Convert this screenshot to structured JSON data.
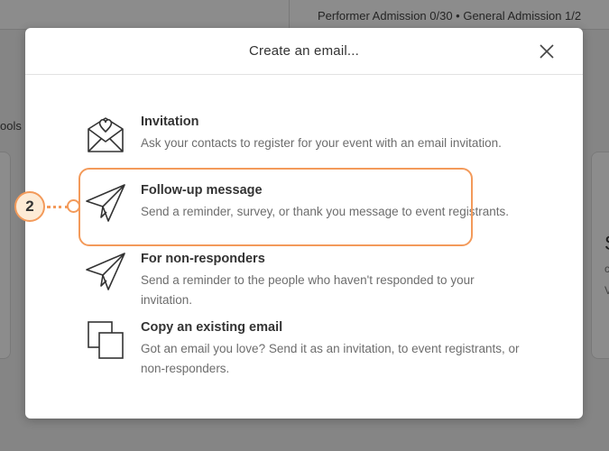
{
  "background": {
    "admission_text": "Performer Admission 0/30 • General Admission 1/2",
    "tools_text": "ools",
    "right_card": {
      "s": "S",
      "c": "c",
      "v": "V"
    }
  },
  "modal": {
    "title": "Create an email...",
    "close_icon": "close-icon",
    "options": [
      {
        "icon": "envelope-heart-icon",
        "title": "Invitation",
        "desc": "Ask your contacts to register for your event with an email invitation."
      },
      {
        "icon": "paper-plane-icon",
        "title": "Follow-up message",
        "desc": "Send a reminder, survey, or thank you message to event registrants."
      },
      {
        "icon": "paper-plane-icon",
        "title": "For non-responders",
        "desc": "Send a reminder to the people who haven't responded to your invitation."
      },
      {
        "icon": "copy-icon",
        "title": "Copy an existing email",
        "desc": "Got an email you love? Send it as an invitation, to event registrants, or non-responders."
      }
    ]
  },
  "callout": {
    "number": "2",
    "color": "#f39a5a"
  }
}
